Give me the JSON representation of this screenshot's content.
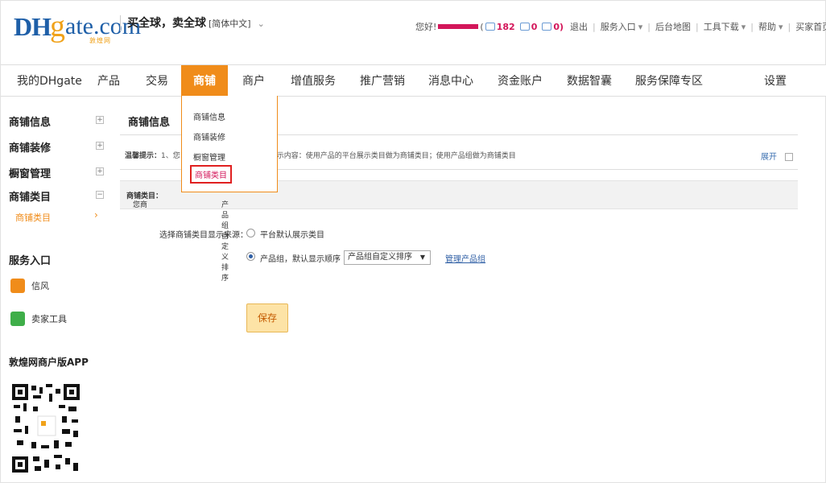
{
  "header": {
    "logo": {
      "dh": "DH",
      "g": "g",
      "ate": "ate.com",
      "sub": "敦煌网"
    },
    "slogan": "买全球，卖全球",
    "lang": "[简体中文]",
    "greeting": "您好!",
    "paren_open": "(",
    "msg_count": "182",
    "comment_count": "0",
    "other_count": "0",
    "paren_close": ")",
    "links": [
      "退出",
      "服务入口",
      "后台地图",
      "工具下载",
      "帮助",
      "买家首页"
    ]
  },
  "nav": {
    "items": [
      "我的DHgate",
      "产品",
      "交易",
      "商铺",
      "商户",
      "增值服务",
      "推广营销",
      "消息中心",
      "资金账户",
      "数据智囊",
      "服务保障专区",
      "设置"
    ],
    "active": "商铺"
  },
  "sidebar": {
    "groups": [
      "商铺信息",
      "商铺装修",
      "橱窗管理",
      "商铺类目"
    ],
    "active_sub": "商铺类目",
    "service_title": "服务入口",
    "tools": [
      "信风",
      "卖家工具"
    ],
    "app_title": "敦煌网商户版APP"
  },
  "dropdown": {
    "items": [
      "商铺信息",
      "商铺装修",
      "橱窗管理",
      "商铺类目"
    ],
    "selected": "商铺类目"
  },
  "main": {
    "title": "商铺信息",
    "tip_label": "温馨提示：",
    "tip_fragment_a": "1、您",
    "tip_fragment_b": "示内容：使用产品的平台展示类目做为商铺类目；使用产品组做为商铺类目",
    "expand": "展开",
    "band_label": "商铺类目：",
    "band_text_a": "您商",
    "band_text_b": "产品组自定义排序",
    "source_label": "选择商铺类目显示来源：",
    "option1": "平台默认展示类目",
    "option2": "产品组，默认显示顺序",
    "select_value": "产品组自定义排序",
    "manage_link": "管理产品组",
    "save": "保存"
  },
  "colors": {
    "brand": "#1e5fa8",
    "accent": "#f08c1a",
    "highlight": "#e02020"
  }
}
